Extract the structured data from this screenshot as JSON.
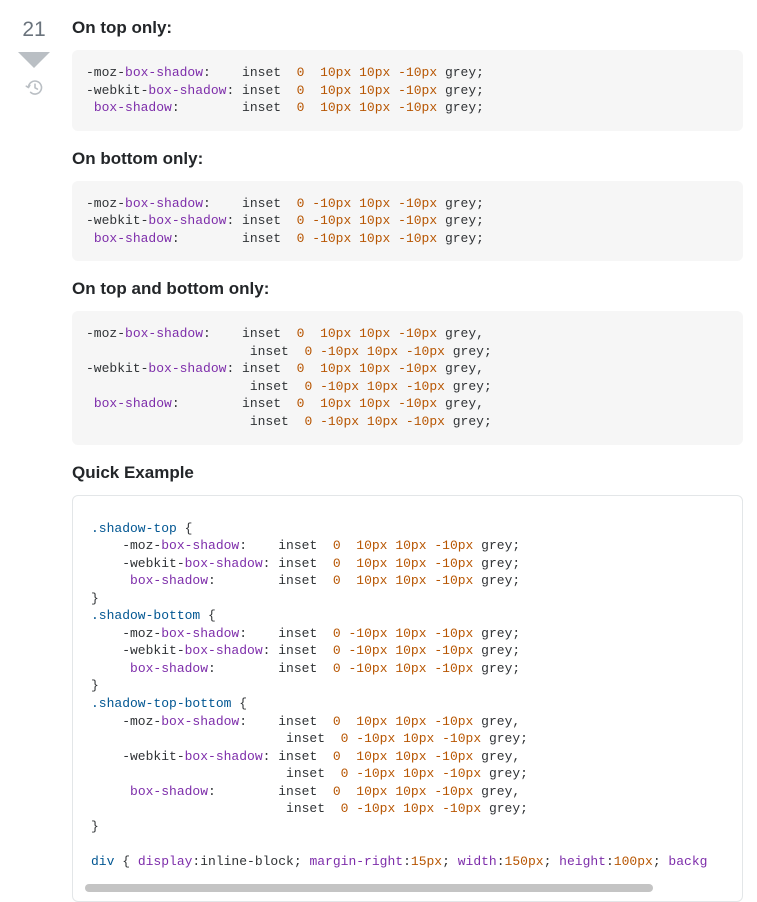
{
  "vote": {
    "score": "21"
  },
  "headings": {
    "top_only": "On top only:",
    "bottom_only": "On bottom only:",
    "top_bottom": "On top and bottom only:",
    "quick_example": "Quick Example"
  },
  "lines": {
    "top_only": [
      [
        [
          "prop",
          "-moz-"
        ],
        [
          "purple",
          "box-shadow"
        ],
        [
          "prop",
          ":    inset  "
        ],
        [
          "orange",
          "0"
        ],
        [
          "prop",
          "  "
        ],
        [
          "orange",
          "10px"
        ],
        [
          "prop",
          " "
        ],
        [
          "orange",
          "10px"
        ],
        [
          "prop",
          " "
        ],
        [
          "orange",
          "-10px"
        ],
        [
          "prop",
          " grey;"
        ]
      ],
      [
        [
          "prop",
          "-webkit-"
        ],
        [
          "purple",
          "box-shadow"
        ],
        [
          "prop",
          ": inset  "
        ],
        [
          "orange",
          "0"
        ],
        [
          "prop",
          "  "
        ],
        [
          "orange",
          "10px"
        ],
        [
          "prop",
          " "
        ],
        [
          "orange",
          "10px"
        ],
        [
          "prop",
          " "
        ],
        [
          "orange",
          "-10px"
        ],
        [
          "prop",
          " grey;"
        ]
      ],
      [
        [
          "prop",
          " "
        ],
        [
          "purple",
          "box-shadow"
        ],
        [
          "prop",
          ":        inset  "
        ],
        [
          "orange",
          "0"
        ],
        [
          "prop",
          "  "
        ],
        [
          "orange",
          "10px"
        ],
        [
          "prop",
          " "
        ],
        [
          "orange",
          "10px"
        ],
        [
          "prop",
          " "
        ],
        [
          "orange",
          "-10px"
        ],
        [
          "prop",
          " grey;"
        ]
      ]
    ],
    "bottom_only": [
      [
        [
          "prop",
          "-moz-"
        ],
        [
          "purple",
          "box-shadow"
        ],
        [
          "prop",
          ":    inset  "
        ],
        [
          "orange",
          "0"
        ],
        [
          "prop",
          " "
        ],
        [
          "orange",
          "-10px"
        ],
        [
          "prop",
          " "
        ],
        [
          "orange",
          "10px"
        ],
        [
          "prop",
          " "
        ],
        [
          "orange",
          "-10px"
        ],
        [
          "prop",
          " grey;"
        ]
      ],
      [
        [
          "prop",
          "-webkit-"
        ],
        [
          "purple",
          "box-shadow"
        ],
        [
          "prop",
          ": inset  "
        ],
        [
          "orange",
          "0"
        ],
        [
          "prop",
          " "
        ],
        [
          "orange",
          "-10px"
        ],
        [
          "prop",
          " "
        ],
        [
          "orange",
          "10px"
        ],
        [
          "prop",
          " "
        ],
        [
          "orange",
          "-10px"
        ],
        [
          "prop",
          " grey;"
        ]
      ],
      [
        [
          "prop",
          " "
        ],
        [
          "purple",
          "box-shadow"
        ],
        [
          "prop",
          ":        inset  "
        ],
        [
          "orange",
          "0"
        ],
        [
          "prop",
          " "
        ],
        [
          "orange",
          "-10px"
        ],
        [
          "prop",
          " "
        ],
        [
          "orange",
          "10px"
        ],
        [
          "prop",
          " "
        ],
        [
          "orange",
          "-10px"
        ],
        [
          "prop",
          " grey;"
        ]
      ]
    ],
    "top_bottom": [
      [
        [
          "prop",
          "-moz-"
        ],
        [
          "purple",
          "box-shadow"
        ],
        [
          "prop",
          ":    inset  "
        ],
        [
          "orange",
          "0"
        ],
        [
          "prop",
          "  "
        ],
        [
          "orange",
          "10px"
        ],
        [
          "prop",
          " "
        ],
        [
          "orange",
          "10px"
        ],
        [
          "prop",
          " "
        ],
        [
          "orange",
          "-10px"
        ],
        [
          "prop",
          " grey,"
        ]
      ],
      [
        [
          "prop",
          "                     inset  "
        ],
        [
          "orange",
          "0"
        ],
        [
          "prop",
          " "
        ],
        [
          "orange",
          "-10px"
        ],
        [
          "prop",
          " "
        ],
        [
          "orange",
          "10px"
        ],
        [
          "prop",
          " "
        ],
        [
          "orange",
          "-10px"
        ],
        [
          "prop",
          " grey;"
        ]
      ],
      [
        [
          "prop",
          "-webkit-"
        ],
        [
          "purple",
          "box-shadow"
        ],
        [
          "prop",
          ": inset  "
        ],
        [
          "orange",
          "0"
        ],
        [
          "prop",
          "  "
        ],
        [
          "orange",
          "10px"
        ],
        [
          "prop",
          " "
        ],
        [
          "orange",
          "10px"
        ],
        [
          "prop",
          " "
        ],
        [
          "orange",
          "-10px"
        ],
        [
          "prop",
          " grey,"
        ]
      ],
      [
        [
          "prop",
          "                     inset  "
        ],
        [
          "orange",
          "0"
        ],
        [
          "prop",
          " "
        ],
        [
          "orange",
          "-10px"
        ],
        [
          "prop",
          " "
        ],
        [
          "orange",
          "10px"
        ],
        [
          "prop",
          " "
        ],
        [
          "orange",
          "-10px"
        ],
        [
          "prop",
          " grey;"
        ]
      ],
      [
        [
          "prop",
          " "
        ],
        [
          "purple",
          "box-shadow"
        ],
        [
          "prop",
          ":        inset  "
        ],
        [
          "orange",
          "0"
        ],
        [
          "prop",
          "  "
        ],
        [
          "orange",
          "10px"
        ],
        [
          "prop",
          " "
        ],
        [
          "orange",
          "10px"
        ],
        [
          "prop",
          " "
        ],
        [
          "orange",
          "-10px"
        ],
        [
          "prop",
          " grey,"
        ]
      ],
      [
        [
          "prop",
          "                     inset  "
        ],
        [
          "orange",
          "0"
        ],
        [
          "prop",
          " "
        ],
        [
          "orange",
          "-10px"
        ],
        [
          "prop",
          " "
        ],
        [
          "orange",
          "10px"
        ],
        [
          "prop",
          " "
        ],
        [
          "orange",
          "-10px"
        ],
        [
          "prop",
          " grey;"
        ]
      ]
    ],
    "quick": [
      [
        [
          "sel",
          ".shadow-top"
        ],
        [
          "brace",
          " {"
        ]
      ],
      [
        [
          "prop",
          "    -moz-"
        ],
        [
          "purple",
          "box-shadow"
        ],
        [
          "prop",
          ":    inset  "
        ],
        [
          "orange",
          "0"
        ],
        [
          "prop",
          "  "
        ],
        [
          "orange",
          "10px"
        ],
        [
          "prop",
          " "
        ],
        [
          "orange",
          "10px"
        ],
        [
          "prop",
          " "
        ],
        [
          "orange",
          "-10px"
        ],
        [
          "prop",
          " grey;"
        ]
      ],
      [
        [
          "prop",
          "    -webkit-"
        ],
        [
          "purple",
          "box-shadow"
        ],
        [
          "prop",
          ": inset  "
        ],
        [
          "orange",
          "0"
        ],
        [
          "prop",
          "  "
        ],
        [
          "orange",
          "10px"
        ],
        [
          "prop",
          " "
        ],
        [
          "orange",
          "10px"
        ],
        [
          "prop",
          " "
        ],
        [
          "orange",
          "-10px"
        ],
        [
          "prop",
          " grey;"
        ]
      ],
      [
        [
          "prop",
          "     "
        ],
        [
          "purple",
          "box-shadow"
        ],
        [
          "prop",
          ":        inset  "
        ],
        [
          "orange",
          "0"
        ],
        [
          "prop",
          "  "
        ],
        [
          "orange",
          "10px"
        ],
        [
          "prop",
          " "
        ],
        [
          "orange",
          "10px"
        ],
        [
          "prop",
          " "
        ],
        [
          "orange",
          "-10px"
        ],
        [
          "prop",
          " grey;"
        ]
      ],
      [
        [
          "brace",
          "}"
        ]
      ],
      [
        [
          "sel",
          ".shadow-bottom"
        ],
        [
          "brace",
          " {"
        ]
      ],
      [
        [
          "prop",
          "    -moz-"
        ],
        [
          "purple",
          "box-shadow"
        ],
        [
          "prop",
          ":    inset  "
        ],
        [
          "orange",
          "0"
        ],
        [
          "prop",
          " "
        ],
        [
          "orange",
          "-10px"
        ],
        [
          "prop",
          " "
        ],
        [
          "orange",
          "10px"
        ],
        [
          "prop",
          " "
        ],
        [
          "orange",
          "-10px"
        ],
        [
          "prop",
          " grey;"
        ]
      ],
      [
        [
          "prop",
          "    -webkit-"
        ],
        [
          "purple",
          "box-shadow"
        ],
        [
          "prop",
          ": inset  "
        ],
        [
          "orange",
          "0"
        ],
        [
          "prop",
          " "
        ],
        [
          "orange",
          "-10px"
        ],
        [
          "prop",
          " "
        ],
        [
          "orange",
          "10px"
        ],
        [
          "prop",
          " "
        ],
        [
          "orange",
          "-10px"
        ],
        [
          "prop",
          " grey;"
        ]
      ],
      [
        [
          "prop",
          "     "
        ],
        [
          "purple",
          "box-shadow"
        ],
        [
          "prop",
          ":        inset  "
        ],
        [
          "orange",
          "0"
        ],
        [
          "prop",
          " "
        ],
        [
          "orange",
          "-10px"
        ],
        [
          "prop",
          " "
        ],
        [
          "orange",
          "10px"
        ],
        [
          "prop",
          " "
        ],
        [
          "orange",
          "-10px"
        ],
        [
          "prop",
          " grey;"
        ]
      ],
      [
        [
          "brace",
          "}"
        ]
      ],
      [
        [
          "sel",
          ".shadow-top-bottom"
        ],
        [
          "brace",
          " {"
        ]
      ],
      [
        [
          "prop",
          "    -moz-"
        ],
        [
          "purple",
          "box-shadow"
        ],
        [
          "prop",
          ":    inset  "
        ],
        [
          "orange",
          "0"
        ],
        [
          "prop",
          "  "
        ],
        [
          "orange",
          "10px"
        ],
        [
          "prop",
          " "
        ],
        [
          "orange",
          "10px"
        ],
        [
          "prop",
          " "
        ],
        [
          "orange",
          "-10px"
        ],
        [
          "prop",
          " grey,"
        ]
      ],
      [
        [
          "prop",
          "                         inset  "
        ],
        [
          "orange",
          "0"
        ],
        [
          "prop",
          " "
        ],
        [
          "orange",
          "-10px"
        ],
        [
          "prop",
          " "
        ],
        [
          "orange",
          "10px"
        ],
        [
          "prop",
          " "
        ],
        [
          "orange",
          "-10px"
        ],
        [
          "prop",
          " grey;"
        ]
      ],
      [
        [
          "prop",
          "    -webkit-"
        ],
        [
          "purple",
          "box-shadow"
        ],
        [
          "prop",
          ": inset  "
        ],
        [
          "orange",
          "0"
        ],
        [
          "prop",
          "  "
        ],
        [
          "orange",
          "10px"
        ],
        [
          "prop",
          " "
        ],
        [
          "orange",
          "10px"
        ],
        [
          "prop",
          " "
        ],
        [
          "orange",
          "-10px"
        ],
        [
          "prop",
          " grey,"
        ]
      ],
      [
        [
          "prop",
          "                         inset  "
        ],
        [
          "orange",
          "0"
        ],
        [
          "prop",
          " "
        ],
        [
          "orange",
          "-10px"
        ],
        [
          "prop",
          " "
        ],
        [
          "orange",
          "10px"
        ],
        [
          "prop",
          " "
        ],
        [
          "orange",
          "-10px"
        ],
        [
          "prop",
          " grey;"
        ]
      ],
      [
        [
          "prop",
          "     "
        ],
        [
          "purple",
          "box-shadow"
        ],
        [
          "prop",
          ":        inset  "
        ],
        [
          "orange",
          "0"
        ],
        [
          "prop",
          "  "
        ],
        [
          "orange",
          "10px"
        ],
        [
          "prop",
          " "
        ],
        [
          "orange",
          "10px"
        ],
        [
          "prop",
          " "
        ],
        [
          "orange",
          "-10px"
        ],
        [
          "prop",
          " grey,"
        ]
      ],
      [
        [
          "prop",
          "                         inset  "
        ],
        [
          "orange",
          "0"
        ],
        [
          "prop",
          " "
        ],
        [
          "orange",
          "-10px"
        ],
        [
          "prop",
          " "
        ],
        [
          "orange",
          "10px"
        ],
        [
          "prop",
          " "
        ],
        [
          "orange",
          "-10px"
        ],
        [
          "prop",
          " grey;"
        ]
      ],
      [
        [
          "brace",
          "}"
        ]
      ],
      [
        [
          "prop",
          ""
        ]
      ],
      [
        [
          "sel",
          "div"
        ],
        [
          "brace",
          " { "
        ],
        [
          "purple",
          "display"
        ],
        [
          "prop",
          ":inline-block; "
        ],
        [
          "purple",
          "margin-right"
        ],
        [
          "prop",
          ":"
        ],
        [
          "orange",
          "15px"
        ],
        [
          "prop",
          "; "
        ],
        [
          "purple",
          "width"
        ],
        [
          "prop",
          ":"
        ],
        [
          "orange",
          "150px"
        ],
        [
          "prop",
          "; "
        ],
        [
          "purple",
          "height"
        ],
        [
          "prop",
          ":"
        ],
        [
          "orange",
          "100px"
        ],
        [
          "prop",
          "; "
        ],
        [
          "purple",
          "backg"
        ]
      ]
    ]
  }
}
